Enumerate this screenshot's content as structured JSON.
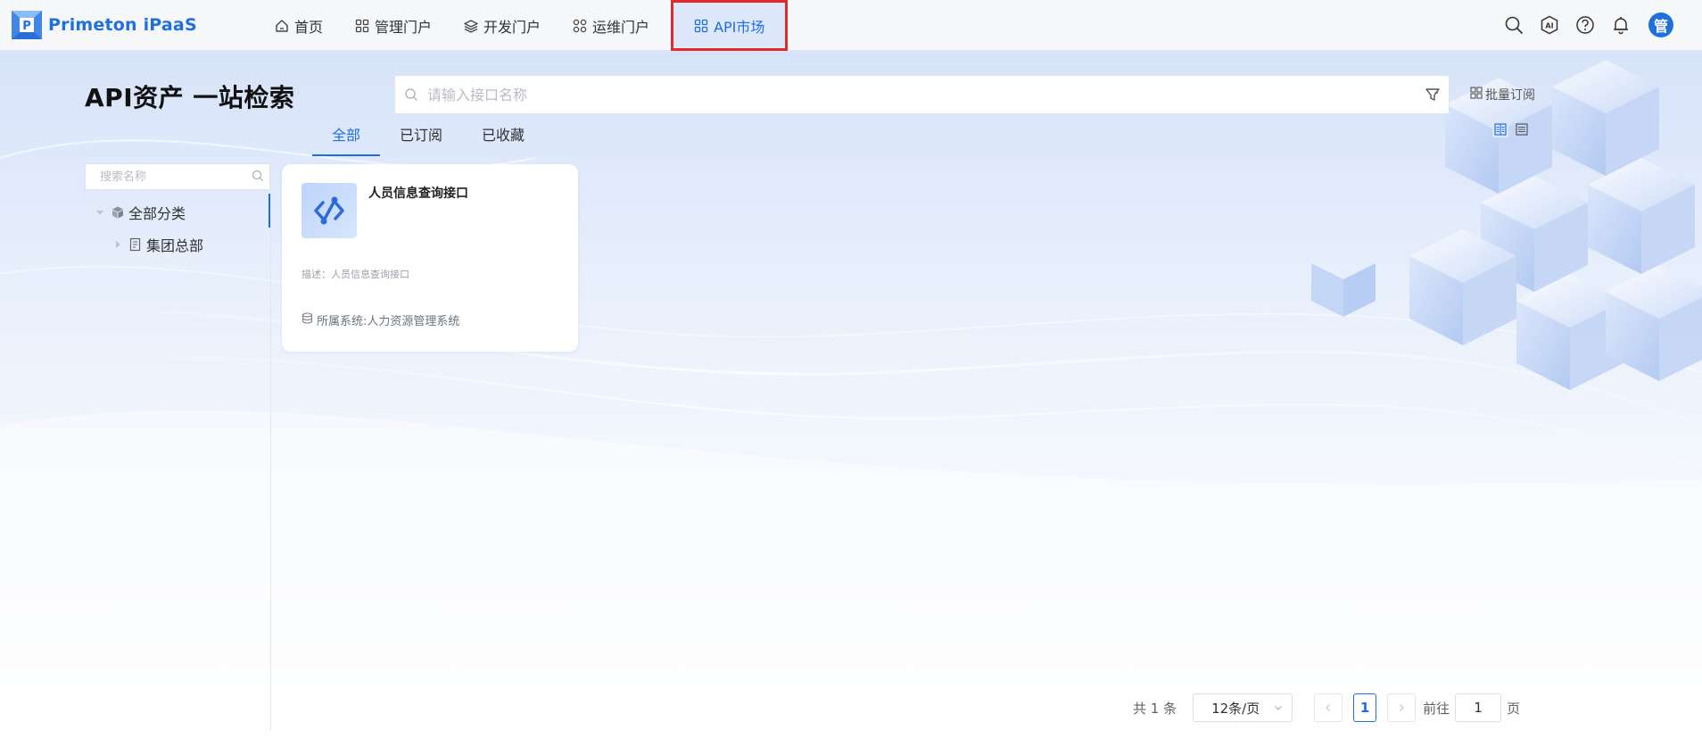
{
  "app": {
    "name": "Primeton iPaaS"
  },
  "nav": {
    "items": [
      {
        "label": "首页",
        "icon": "home-icon"
      },
      {
        "label": "管理门户",
        "icon": "grid-icon"
      },
      {
        "label": "开发门户",
        "icon": "layers-icon"
      },
      {
        "label": "运维门户",
        "icon": "apps-icon"
      },
      {
        "label": "API市场",
        "icon": "grid-icon",
        "active": true
      }
    ]
  },
  "user": {
    "avatar_text": "管"
  },
  "page": {
    "title": "API资产 一站检索"
  },
  "search": {
    "placeholder": "请输入接口名称"
  },
  "batch_subscribe": "批量订阅",
  "tabs": [
    {
      "label": "全部",
      "active": true
    },
    {
      "label": "已订阅"
    },
    {
      "label": "已收藏"
    }
  ],
  "sidebar": {
    "search_placeholder": "搜索名称",
    "tree": [
      {
        "label": "全部分类",
        "level": 0,
        "expanded": true
      },
      {
        "label": "集团总部",
        "level": 1,
        "expanded": false
      }
    ]
  },
  "cards": [
    {
      "title": "人员信息查询接口",
      "description": "描述：人员信息查询接口",
      "system": "所属系统:人力资源管理系统"
    }
  ],
  "pagination": {
    "total_text": "共 1 条",
    "page_size": "12条/页",
    "current_page": "1",
    "goto_label": "前往",
    "goto_value": "1",
    "page_suffix": "页"
  },
  "colors": {
    "primary": "#1f6fe0",
    "highlight_border": "#e32a2a"
  }
}
